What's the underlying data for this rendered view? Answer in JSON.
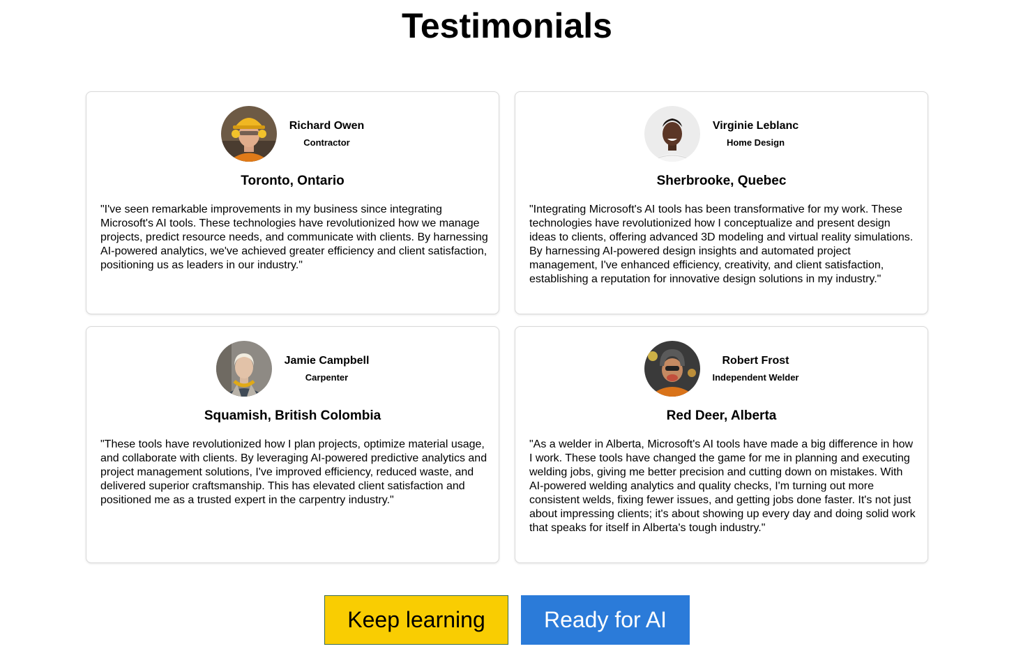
{
  "page": {
    "title": "Testimonials"
  },
  "testimonials": [
    {
      "name": "Richard Owen",
      "role": "Contractor",
      "location": "Toronto, Ontario",
      "quote": "\"I've seen remarkable improvements in my business since integrating Microsoft's AI tools. These technologies have revolutionized how we manage projects, predict resource needs, and communicate with clients. By harnessing AI-powered analytics, we've achieved greater efficiency and client satisfaction, positioning us as leaders in our industry.\"",
      "avatar": "hard-hat-contractor-photo"
    },
    {
      "name": "Virginie Leblanc",
      "role": "Home Design",
      "location": "Sherbrooke, Quebec",
      "quote": "\"Integrating Microsoft's AI tools has been transformative for my work. These technologies have revolutionized how I conceptualize and present design ideas to clients, offering advanced 3D modeling and virtual reality simulations. By harnessing AI-powered design insights and automated project management, I've enhanced efficiency, creativity, and client satisfaction, establishing a reputation for innovative design solutions in my industry.\"",
      "avatar": "smiling-designer-photo"
    },
    {
      "name": "Jamie Campbell",
      "role": "Carpenter",
      "location": "Squamish, British Colombia",
      "quote": "\"These tools have revolutionized how I plan projects, optimize material usage, and collaborate with clients. By leveraging AI-powered predictive analytics and project management solutions, I've improved efficiency, reduced waste, and delivered superior craftsmanship. This has elevated client satisfaction and positioned me as a trusted expert in the carpentry industry.\"",
      "avatar": "carpenter-with-ear-defenders-photo"
    },
    {
      "name": "Robert Frost",
      "role": "Independent Welder",
      "location": "Red Deer, Alberta",
      "quote": "\"As a welder in Alberta, Microsoft's AI tools have made a big difference in how I work. These tools have changed the game for me in planning and executing welding jobs, giving me better precision and cutting down on mistakes. With AI-powered welding analytics and quality checks, I'm turning out more consistent welds, fixing fewer issues, and getting jobs done faster. It's not just about impressing clients; it's about showing up every day and doing solid work that speaks for itself in Alberta's tough industry.\"",
      "avatar": "welder-with-helmet-photo"
    }
  ],
  "buttons": {
    "keep_learning": "Keep learning",
    "ready_for_ai": "Ready for AI"
  },
  "colors": {
    "keep_learning_bg": "#f9cd02",
    "ready_for_ai_bg": "#2b7bd9"
  }
}
